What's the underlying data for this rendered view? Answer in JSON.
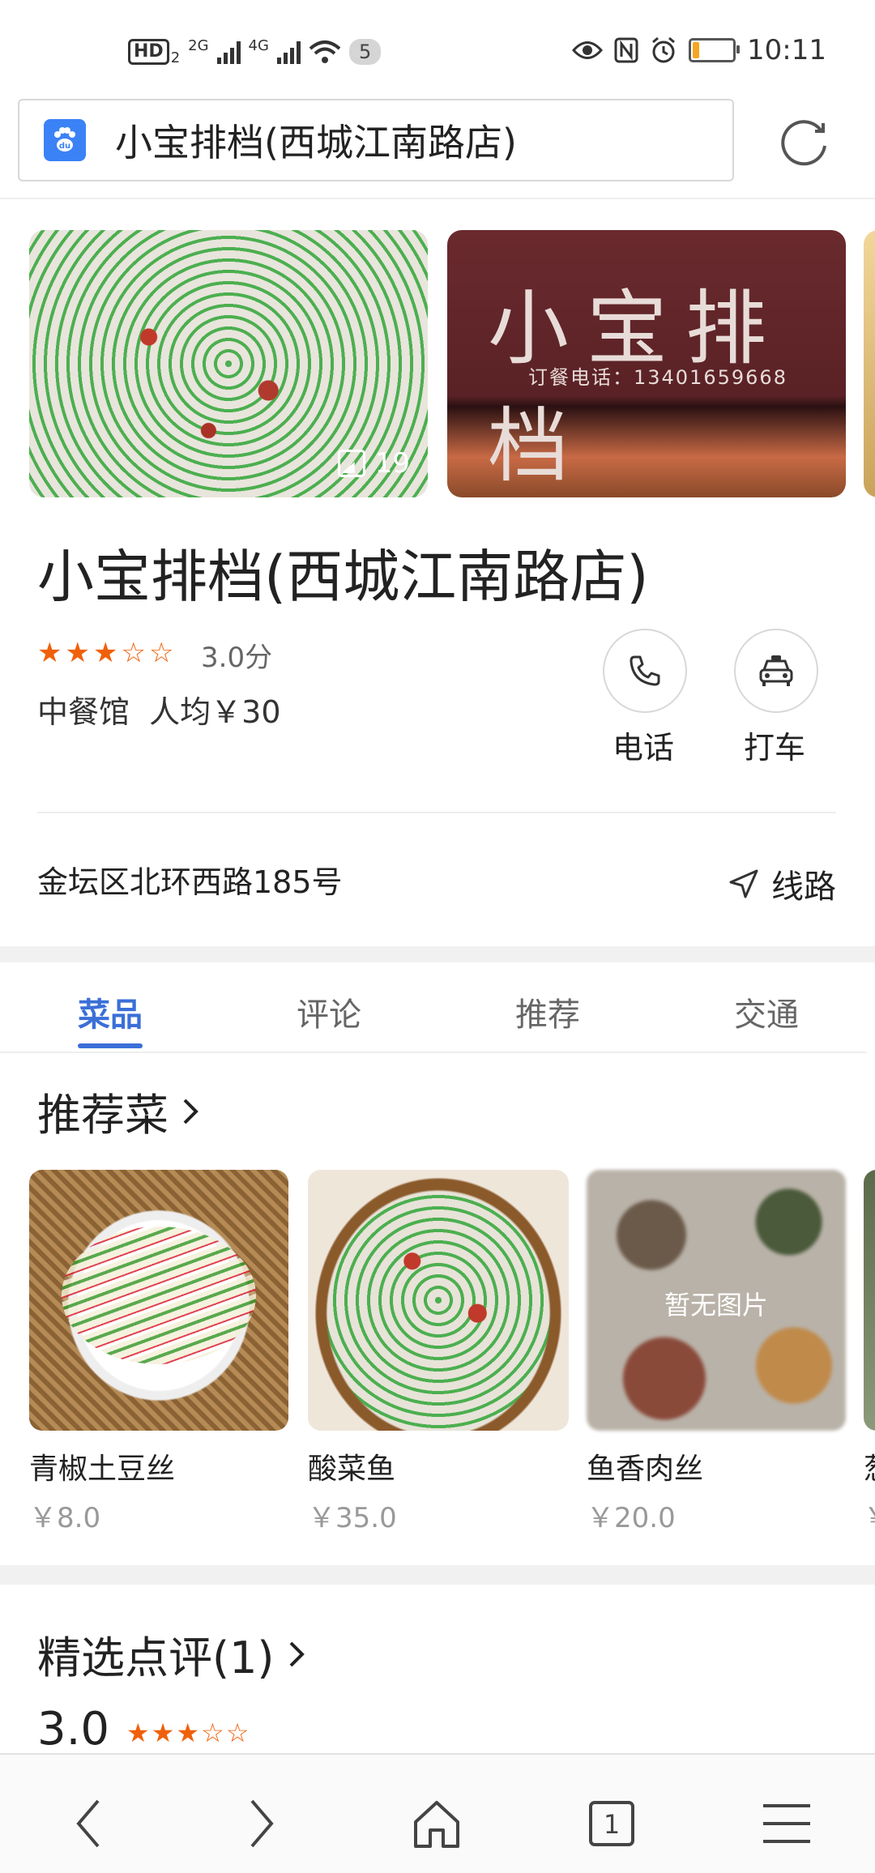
{
  "status_bar": {
    "hd_label": "HD",
    "hd_sub": "2",
    "net1": "2G",
    "net2": "4G",
    "notification_count": "5",
    "time": "10:11",
    "battery_level": 0.18
  },
  "url_bar": {
    "text": "小宝排档(西城江南路店)",
    "site_icon": "baidu-paw-icon"
  },
  "photos": {
    "count": "19",
    "storefront_sign": "小宝排档",
    "storefront_phone": "订餐电话：13401659668"
  },
  "shop": {
    "name": "小宝排档(西城江南路店)",
    "rating_stars": 3,
    "score_text": "3.0分",
    "category_price": "中餐馆  人均￥30",
    "address": "金坛区北环西路185号"
  },
  "actions": {
    "call_label": "电话",
    "taxi_label": "打车",
    "route_label": "线路"
  },
  "tabs": [
    "菜品",
    "评论",
    "推荐",
    "交通"
  ],
  "active_tab": 0,
  "recommended": {
    "heading": "推荐菜",
    "no_image_text": "暂无图片",
    "dishes": [
      {
        "name": "青椒土豆丝",
        "price": "￥8.0"
      },
      {
        "name": "酸菜鱼",
        "price": "￥35.0"
      },
      {
        "name": "鱼香肉丝",
        "price": "￥20.0"
      },
      {
        "name": "葱",
        "price": "￥"
      }
    ]
  },
  "reviews": {
    "heading": "精选点评(1)",
    "score": "3.0",
    "stars": 3
  },
  "colors": {
    "accent": "#3b6fd8",
    "star": "#f0600a",
    "battery": "#f5a623"
  },
  "nav_icons": [
    "back-icon",
    "forward-icon",
    "home-icon",
    "tabs-icon",
    "menu-icon"
  ],
  "nav_tab_count": "1"
}
